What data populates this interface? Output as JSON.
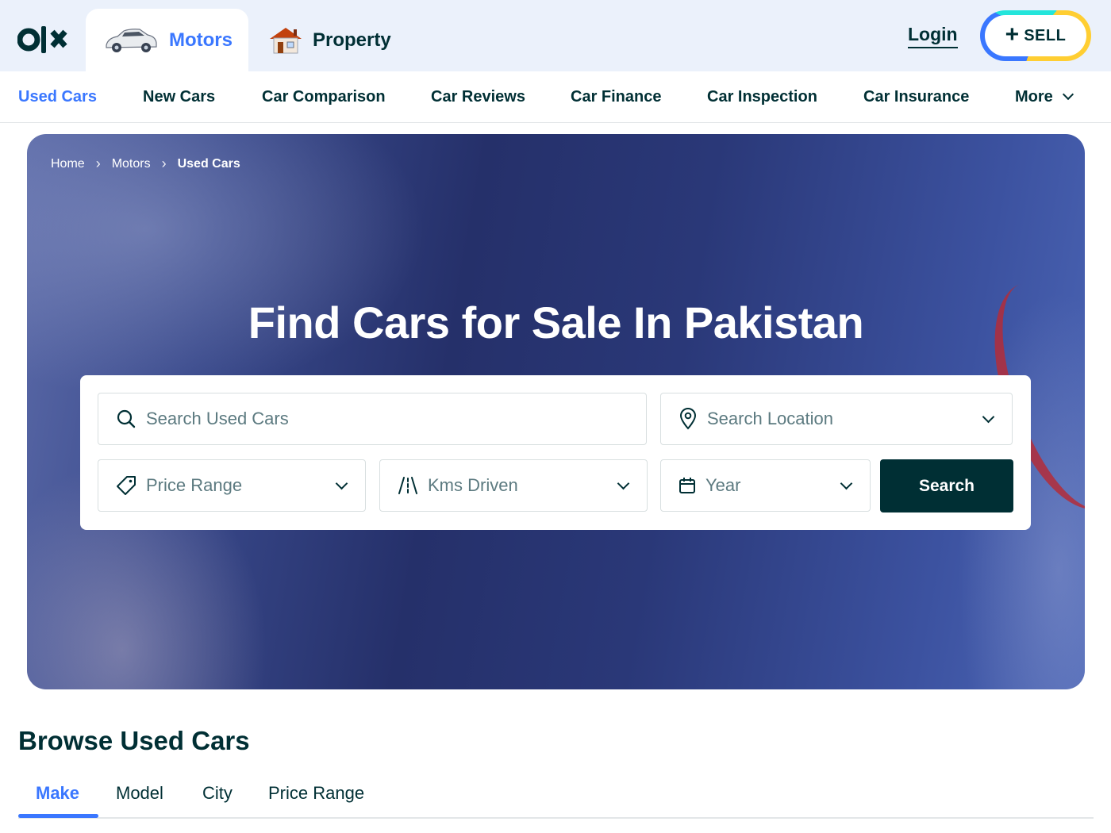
{
  "header": {
    "logo_text": "olx",
    "tabs": [
      {
        "label": "Motors",
        "icon": "car-icon",
        "active": true
      },
      {
        "label": "Property",
        "icon": "house-icon",
        "active": false
      }
    ],
    "login_label": "Login",
    "sell_label": "SELL"
  },
  "subnav": {
    "items": [
      {
        "label": "Used Cars",
        "active": true
      },
      {
        "label": "New Cars"
      },
      {
        "label": "Car Comparison"
      },
      {
        "label": "Car Reviews"
      },
      {
        "label": "Car Finance"
      },
      {
        "label": "Car Inspection"
      },
      {
        "label": "Car Insurance"
      },
      {
        "label": "More"
      }
    ]
  },
  "hero": {
    "breadcrumb": [
      "Home",
      "Motors",
      "Used Cars"
    ],
    "title": "Find Cars for Sale In Pakistan"
  },
  "search": {
    "keyword_placeholder": "Search Used Cars",
    "location_placeholder": "Search Location",
    "price_placeholder": "Price Range",
    "kms_placeholder": "Kms Driven",
    "year_placeholder": "Year",
    "button_label": "Search"
  },
  "browse": {
    "title": "Browse Used Cars",
    "tabs": [
      "Make",
      "Model",
      "City",
      "Price Range"
    ],
    "active_tab": "Make"
  },
  "colors": {
    "accent": "#3a77ff",
    "primary_dark": "#002f34",
    "header_bg": "#ebf1fb"
  }
}
